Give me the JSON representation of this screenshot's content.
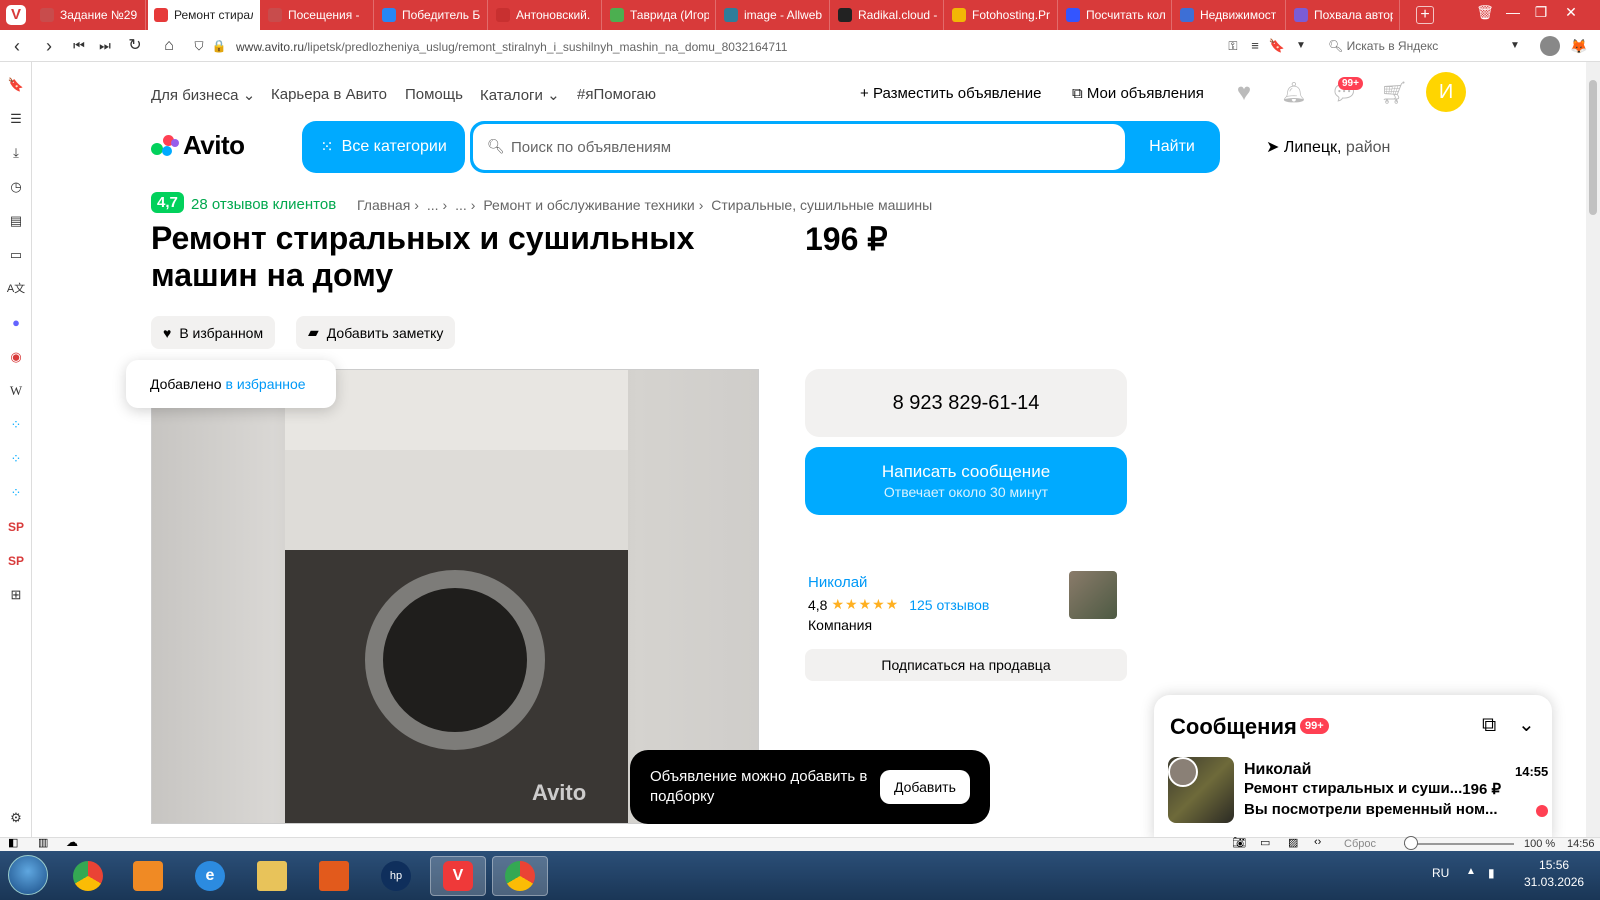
{
  "browser": {
    "tabs": [
      {
        "label": "Задание №29",
        "color": "#c84c4c",
        "active": false
      },
      {
        "label": "Ремонт стирал",
        "color": "#e63a3a",
        "active": true
      },
      {
        "label": "Посещения -",
        "color": "#c84c4c",
        "active": false
      },
      {
        "label": "Победитель Б",
        "color": "#2787f5",
        "active": false
      },
      {
        "label": "Антоновский.",
        "color": "#c83030",
        "active": false
      },
      {
        "label": "Таврида (Игор",
        "color": "#4caf50",
        "active": false
      },
      {
        "label": "image - Allweb",
        "color": "#2e7d9a",
        "active": false
      },
      {
        "label": "Radikal.cloud -",
        "color": "#222222",
        "active": false
      },
      {
        "label": "Fotohosting.Pr",
        "color": "#f2b705",
        "active": false
      },
      {
        "label": "Посчитать кол",
        "color": "#3355ff",
        "active": false
      },
      {
        "label": "Недвижимост",
        "color": "#3d6fd6",
        "active": false
      },
      {
        "label": "Похвала автор",
        "color": "#7b5cd6",
        "active": false
      }
    ],
    "url_host": "www.avito.ru",
    "url_path": "/lipetsk/predlozheniya_uslug/remont_stiralnyh_i_sushilnyh_mashin_na_domu_8032164711",
    "search_placeholder": "Искать в Яндекс",
    "status_reset": "Сброс",
    "zoom": "100 %",
    "status_time": "14:56"
  },
  "header": {
    "nav": [
      "Для бизнеса",
      "Карьера в Авито",
      "Помощь",
      "Каталоги",
      "#яПомогаю"
    ],
    "post_ad": "Разместить объявление",
    "my_ads": "Мои объявления",
    "messages_badge": "99+",
    "user_initial": "И",
    "logo": "Avito",
    "all_categories": "Все категории",
    "search_placeholder": "Поиск по объявлениям",
    "search_button": "Найти",
    "location": "Липецк,",
    "location_extra": "район"
  },
  "breadcrumbs": {
    "rating": "4,7",
    "reviews": "28 отзывов клиентов",
    "items": [
      "Главная",
      "...",
      "...",
      "Ремонт и обслуживание техники",
      "Стиральные, сушильные машины"
    ]
  },
  "listing": {
    "title": "Ремонт стиральных и сушильных машин на дому",
    "price": "196 ₽",
    "favorite_label": "В избранном",
    "note_label": "Добавить заметку",
    "tooltip_text": "Добавлено",
    "tooltip_link": "в избранное",
    "photo_watermark": "Avito"
  },
  "contact": {
    "phone": "8 923 829-61-14",
    "write_message": "Написать сообщение",
    "response_time": "Отвечает около 30 минут"
  },
  "seller": {
    "name": "Николай",
    "rating": "4,8",
    "stars": "★★★★★",
    "reviews": "125 отзывов",
    "type": "Компания",
    "subscribe": "Подписаться на продавца"
  },
  "toast": {
    "text": "Объявление можно добавить в подборку",
    "button": "Добавить"
  },
  "messages": {
    "title": "Сообщения",
    "badge": "99+",
    "item": {
      "name": "Николай",
      "time": "14:55",
      "subject": "Ремонт стиральных и суши...",
      "price": "196 ₽",
      "preview": "Вы посмотрели временный ном..."
    }
  },
  "taskbar": {
    "lang": "RU",
    "time": "15:56",
    "date": "31.03.2026"
  },
  "colors": {
    "accent": "#00aaff",
    "browser": "#d83a3a",
    "rating_green": "#02d15c",
    "badge_red": "#ff4053",
    "user_yellow": "#ffd500"
  }
}
